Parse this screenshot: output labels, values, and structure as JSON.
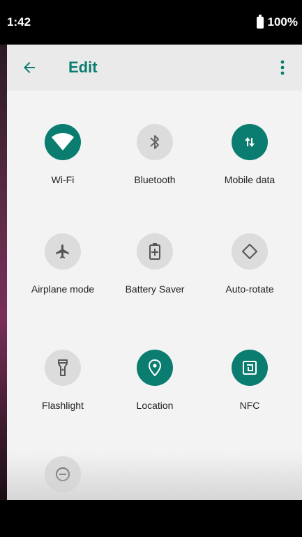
{
  "status_bar": {
    "time": "1:42",
    "battery": "100%"
  },
  "toolbar": {
    "title": "Edit"
  },
  "tiles": [
    {
      "label": "Wi-Fi",
      "icon": "wifi-icon",
      "active": true
    },
    {
      "label": "Bluetooth",
      "icon": "bluetooth-icon",
      "active": false
    },
    {
      "label": "Mobile data",
      "icon": "mobile-data-icon",
      "active": true
    },
    {
      "label": "Airplane mode",
      "icon": "airplane-icon",
      "active": false
    },
    {
      "label": "Battery Saver",
      "icon": "battery-saver-icon",
      "active": false
    },
    {
      "label": "Auto-rotate",
      "icon": "auto-rotate-icon",
      "active": false
    },
    {
      "label": "Flashlight",
      "icon": "flashlight-icon",
      "active": false
    },
    {
      "label": "Location",
      "icon": "location-icon",
      "active": true
    },
    {
      "label": "NFC",
      "icon": "nfc-icon",
      "active": true
    },
    {
      "label": "",
      "icon": "do-not-disturb-icon",
      "active": false
    }
  ],
  "colors": {
    "accent": "#0a7d70",
    "tile_off": "#dcdcdc",
    "panel_bg": "#f3f3f3"
  }
}
